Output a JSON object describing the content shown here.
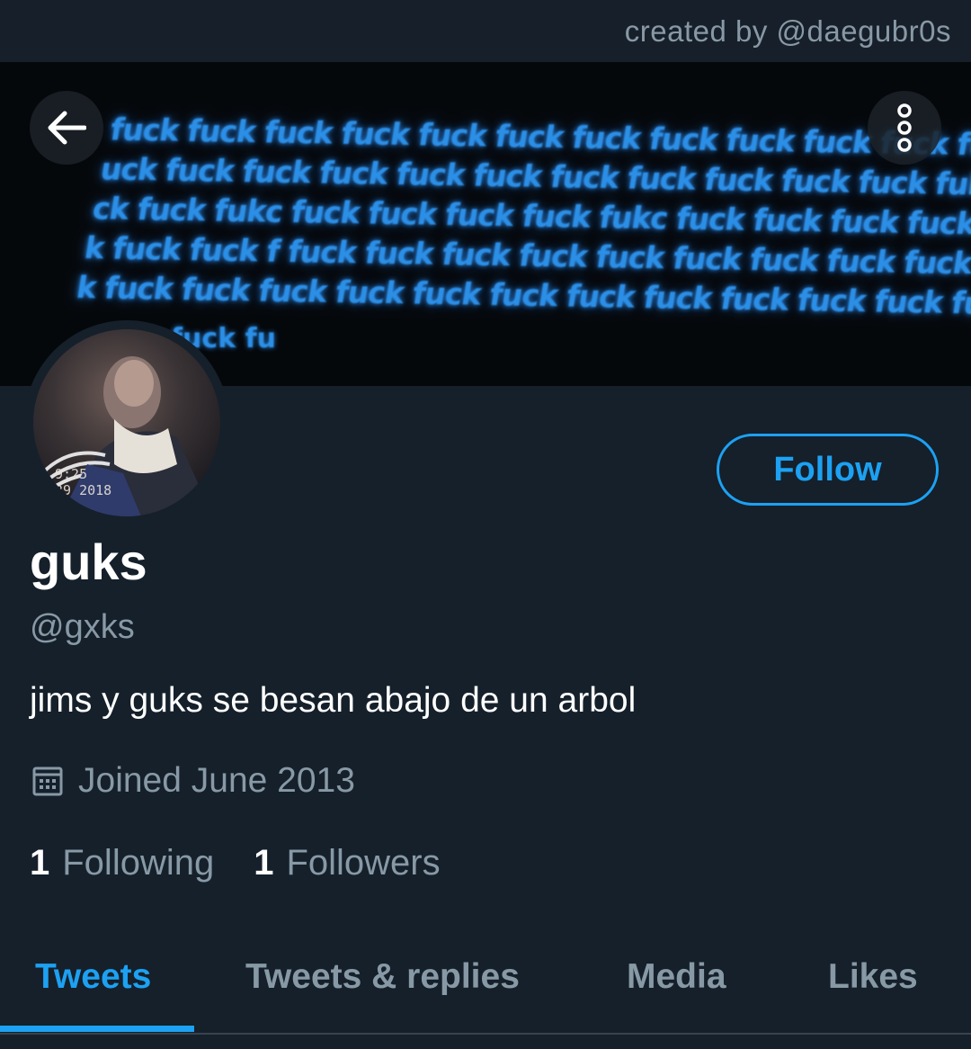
{
  "credit": "created by @daegubr0s",
  "banner": {
    "lines": [
      "fuck fuck fuck fuck fuck fuck fuck fuck fuck fuck fuck fuck fuck fuck f",
      "uck fuck fuck fuck fuck fuck fuck fuck fuck fuck fuck fukcfuck fuck fu",
      "ck fuck fukc fuck fuck fuck fuck fukc fuck fuck fuck fuck fuck fuck fu",
      "k fuck fuck f fuck fuck fuck fuck fuck fuck fuck fuck fuck fuck fuck fu",
      "k fuck fuck fuck fuck fuck fuck fuck fuck fuck fuck fuck fuck fuck fuck"
    ],
    "tail": "fuck fu"
  },
  "avatar": {
    "stamp": "9:25\n29 2018"
  },
  "profile": {
    "name": "guks",
    "handle": "@gxks",
    "bio": "jims y guks se besan abajo de un arbol",
    "joined": "Joined June 2013",
    "following_count": "1",
    "following_label": "Following",
    "followers_count": "1",
    "followers_label": "Followers"
  },
  "actions": {
    "follow_label": "Follow"
  },
  "tabs": [
    {
      "label": "Tweets",
      "active": true
    },
    {
      "label": "Tweets & replies",
      "active": false
    },
    {
      "label": "Media",
      "active": false
    },
    {
      "label": "Likes",
      "active": false
    }
  ],
  "colors": {
    "accent": "#1da1f2",
    "background": "#15202b",
    "secondary_text": "#8899a6"
  },
  "icons": {
    "back": "arrow-left-icon",
    "more": "more-vertical-icon",
    "calendar": "calendar-icon"
  }
}
